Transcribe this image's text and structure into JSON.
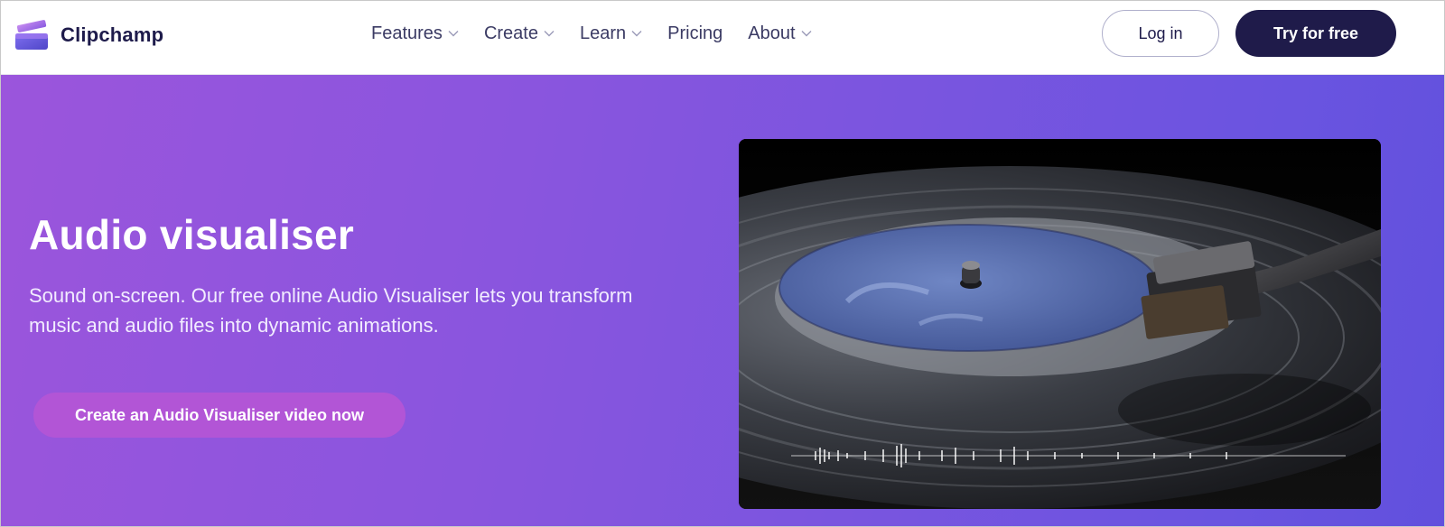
{
  "brand": {
    "name": "Clipchamp"
  },
  "nav": {
    "items": [
      {
        "label": "Features",
        "has_dropdown": true
      },
      {
        "label": "Create",
        "has_dropdown": true
      },
      {
        "label": "Learn",
        "has_dropdown": true
      },
      {
        "label": "Pricing",
        "has_dropdown": false
      },
      {
        "label": "About",
        "has_dropdown": true
      }
    ]
  },
  "header": {
    "login_label": "Log in",
    "try_label": "Try for free"
  },
  "hero": {
    "title": "Audio visualiser",
    "description": "Sound on-screen. Our free online Audio Visualiser lets you transform music and audio files into dynamic animations.",
    "cta_label": "Create an Audio Visualiser video now"
  },
  "colors": {
    "brand_dark": "#1f1b4a",
    "hero_gradient_start": "#9b55dc",
    "hero_gradient_end": "#6150dd",
    "cta": "#b255d6"
  },
  "icons": {
    "logo": "clipchamp-logo-icon",
    "dropdown": "chevron-down-icon",
    "media": "vinyl-record-image"
  }
}
